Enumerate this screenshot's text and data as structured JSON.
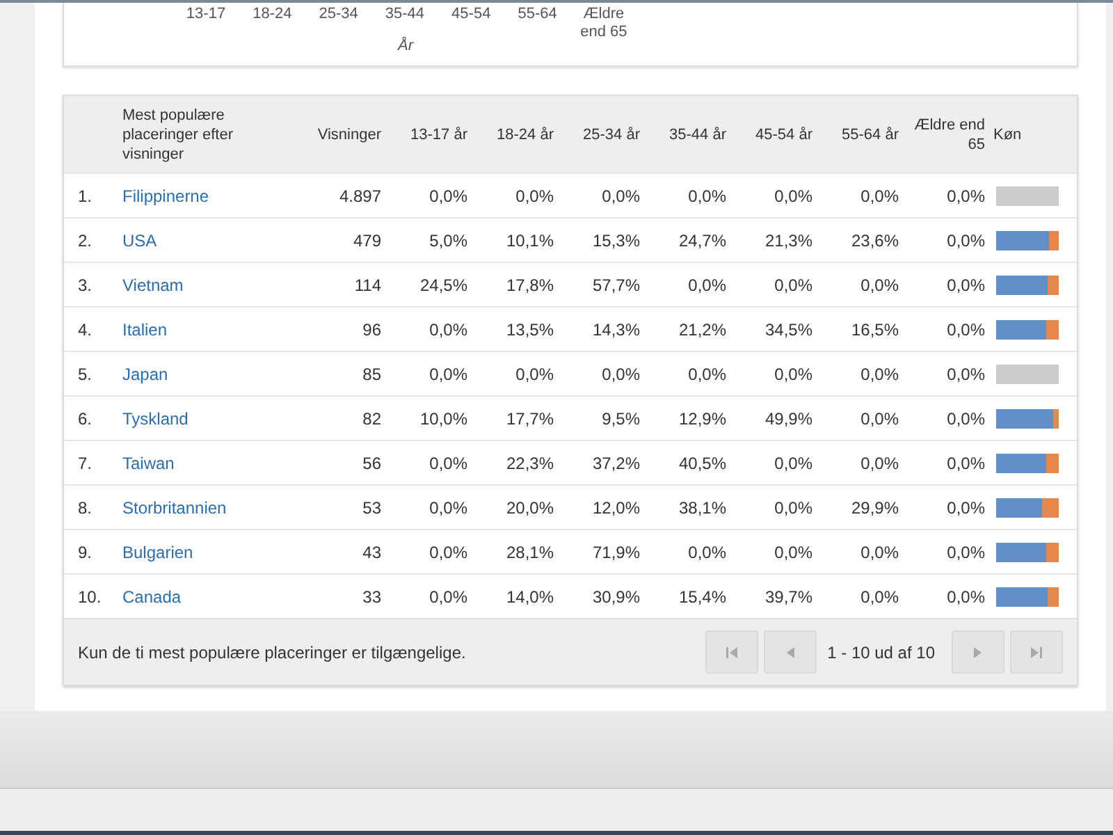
{
  "age_chart": {
    "axis_labels": [
      "13-17",
      "18-24",
      "25-34",
      "35-44",
      "45-54",
      "55-64",
      "Ældre end 65"
    ],
    "axis_title": "År"
  },
  "table": {
    "columns": [
      "Mest populære placeringer efter visninger",
      "Visninger",
      "13-17 år",
      "18-24 år",
      "25-34 år",
      "35-44 år",
      "45-54 år",
      "55-64 år",
      "Ældre end 65",
      "Køn"
    ],
    "rows": [
      {
        "rank": "1.",
        "place": "Filippinerne",
        "views": "4.897",
        "ages": [
          "0,0%",
          "0,0%",
          "0,0%",
          "0,0%",
          "0,0%",
          "0,0%",
          "0,0%"
        ],
        "gender": {
          "kind": "empty"
        }
      },
      {
        "rank": "2.",
        "place": "USA",
        "views": "479",
        "ages": [
          "5,0%",
          "10,1%",
          "15,3%",
          "24,7%",
          "21,3%",
          "23,6%",
          "0,0%"
        ],
        "gender": {
          "kind": "split",
          "level": 0.85
        }
      },
      {
        "rank": "3.",
        "place": "Vietnam",
        "views": "114",
        "ages": [
          "24,5%",
          "17,8%",
          "57,7%",
          "0,0%",
          "0,0%",
          "0,0%",
          "0,0%"
        ],
        "gender": {
          "kind": "split",
          "level": 0.82
        }
      },
      {
        "rank": "4.",
        "place": "Italien",
        "views": "96",
        "ages": [
          "0,0%",
          "13,5%",
          "14,3%",
          "21,2%",
          "34,5%",
          "16,5%",
          "0,0%"
        ],
        "gender": {
          "kind": "split",
          "level": 0.8
        }
      },
      {
        "rank": "5.",
        "place": "Japan",
        "views": "85",
        "ages": [
          "0,0%",
          "0,0%",
          "0,0%",
          "0,0%",
          "0,0%",
          "0,0%",
          "0,0%"
        ],
        "gender": {
          "kind": "empty"
        }
      },
      {
        "rank": "6.",
        "place": "Tyskland",
        "views": "82",
        "ages": [
          "10,0%",
          "17,7%",
          "9,5%",
          "12,9%",
          "49,9%",
          "0,0%",
          "0,0%"
        ],
        "gender": {
          "kind": "split",
          "level": 0.92
        }
      },
      {
        "rank": "7.",
        "place": "Taiwan",
        "views": "56",
        "ages": [
          "0,0%",
          "22,3%",
          "37,2%",
          "40,5%",
          "0,0%",
          "0,0%",
          "0,0%"
        ],
        "gender": {
          "kind": "split",
          "level": 0.8
        }
      },
      {
        "rank": "8.",
        "place": "Storbritannien",
        "views": "53",
        "ages": [
          "0,0%",
          "20,0%",
          "12,0%",
          "38,1%",
          "0,0%",
          "29,9%",
          "0,0%"
        ],
        "gender": {
          "kind": "split",
          "level": 0.74
        }
      },
      {
        "rank": "9.",
        "place": "Bulgarien",
        "views": "43",
        "ages": [
          "0,0%",
          "28,1%",
          "71,9%",
          "0,0%",
          "0,0%",
          "0,0%",
          "0,0%"
        ],
        "gender": {
          "kind": "split",
          "level": 0.8
        }
      },
      {
        "rank": "10.",
        "place": "Canada",
        "views": "33",
        "ages": [
          "0,0%",
          "14,0%",
          "30,9%",
          "15,4%",
          "39,7%",
          "0,0%",
          "0,0%"
        ],
        "gender": {
          "kind": "split",
          "level": 0.82
        }
      }
    ],
    "footer_note": "Kun de ti mest populære placeringer er tilgængelige.",
    "pagination": {
      "range": "1 - 10 ud af 10",
      "first_disabled": true,
      "prev_disabled": true,
      "next_disabled": true,
      "last_disabled": true
    }
  }
}
